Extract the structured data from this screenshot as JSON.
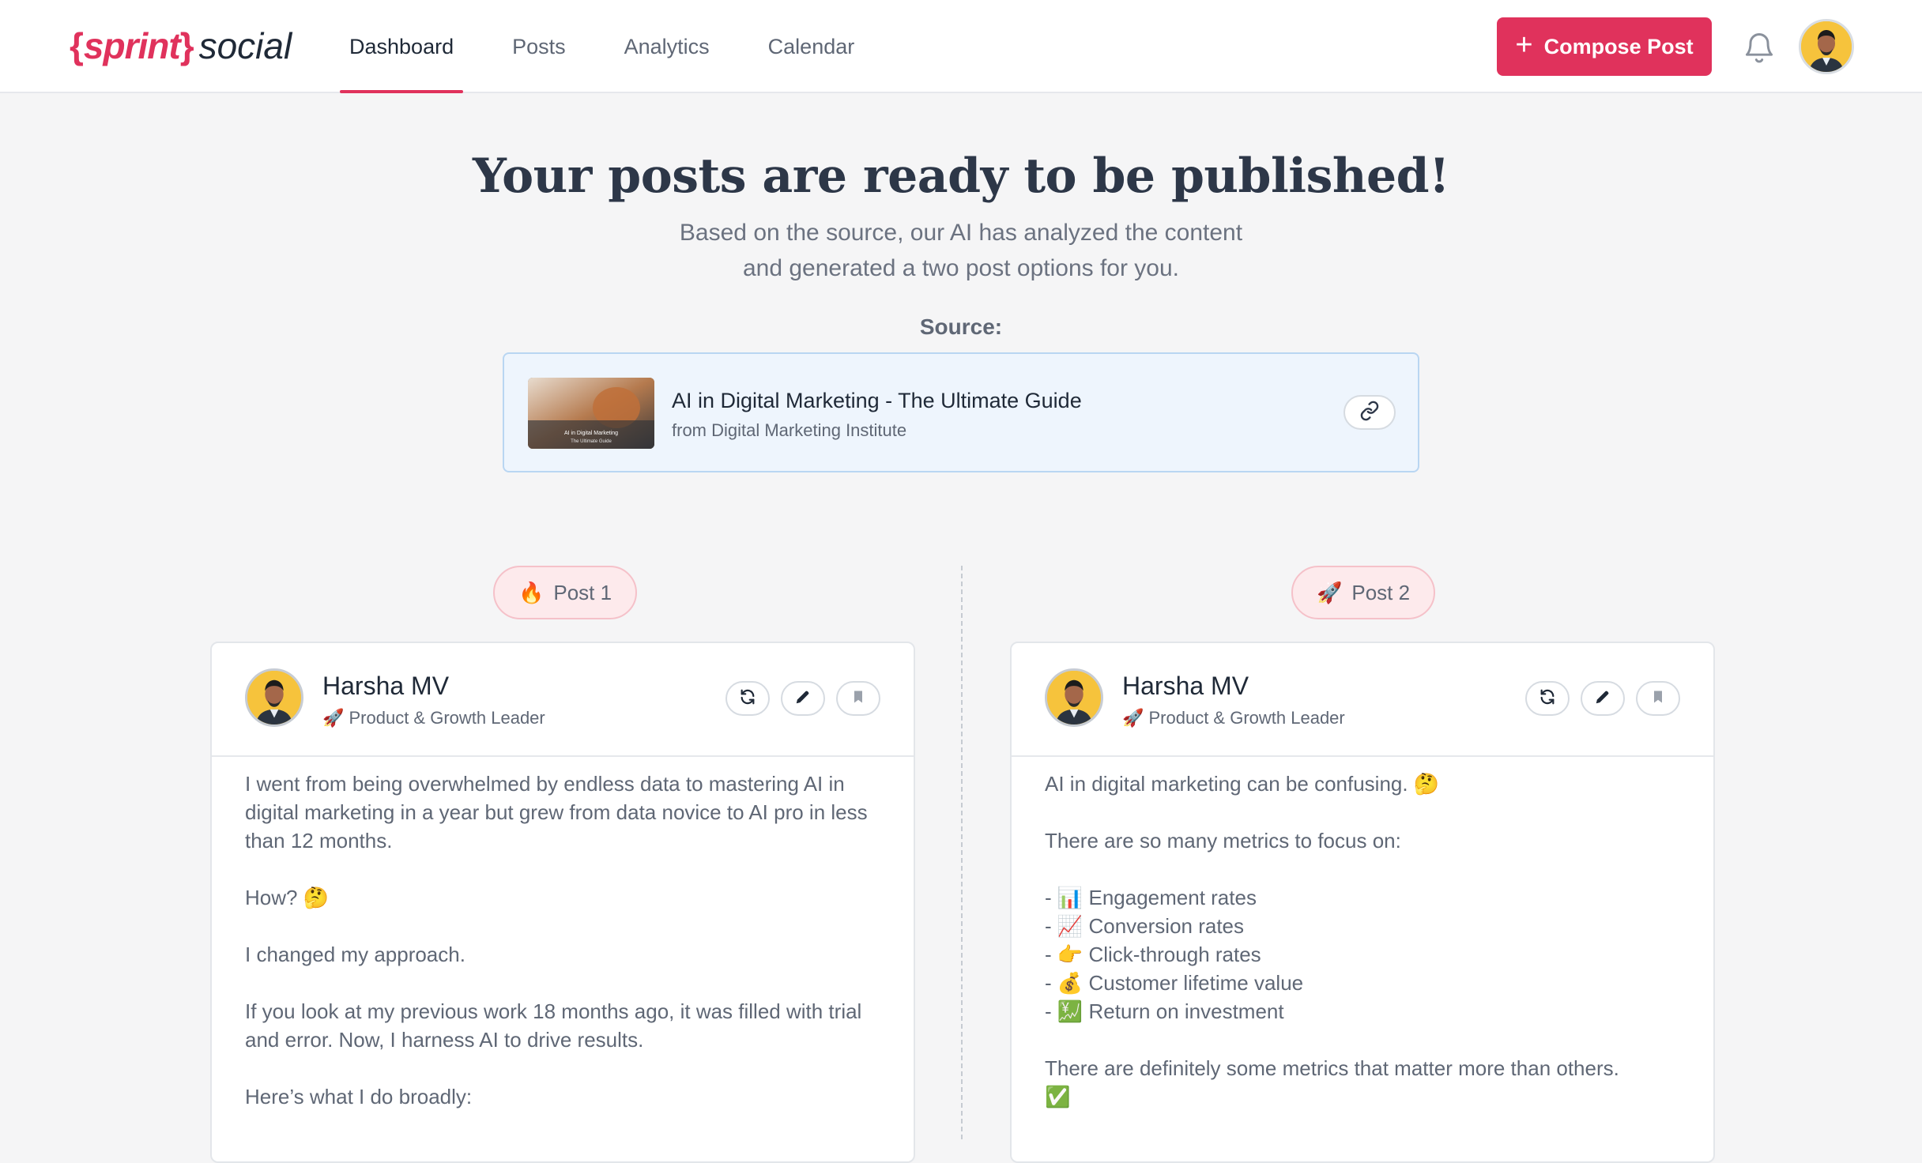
{
  "header": {
    "logo_open_brace": "{",
    "logo_sprint": "sprint",
    "logo_close_brace": "}",
    "logo_social": "social",
    "nav": [
      "Dashboard",
      "Posts",
      "Analytics",
      "Calendar"
    ],
    "active_nav": "Dashboard",
    "compose_label": "Compose Post",
    "compose_icon": "plus-icon",
    "bell_icon": "bell-icon"
  },
  "hero": {
    "title": "Your posts are ready to be published!",
    "subtitle_line1": "Based on the source, our AI has analyzed the content",
    "subtitle_line2": "and generated a two post options for you."
  },
  "source": {
    "label": "Source:",
    "title": "AI in Digital Marketing - The Ultimate Guide",
    "from": "from Digital Marketing Institute",
    "thumb_caption_1": "AI in Digital Marketing",
    "thumb_caption_2": "The Ultimate Guide",
    "link_icon": "link-icon"
  },
  "posts": [
    {
      "tab_emoji": "🔥",
      "tab_label": "Post 1",
      "author": "Harsha MV",
      "role": "🚀 Product & Growth Leader",
      "body": [
        "I went from being overwhelmed by endless data to mastering AI in digital marketing in a year but grew from data novice to AI pro in less than 12 months.",
        "How? 🤔",
        "I changed my approach.",
        "If you look at my previous work 18 months ago, it was filled with trial and error. Now, I harness AI to drive results.",
        "Here’s what I do broadly:"
      ]
    },
    {
      "tab_emoji": "🚀",
      "tab_label": "Post 2",
      "author": "Harsha MV",
      "role": "🚀 Product & Growth Leader",
      "intro": "AI in digital marketing can be confusing. 🤔",
      "lead": "There are so many metrics to focus on:",
      "list": [
        "- 📊 Engagement rates",
        "- 📈 Conversion rates",
        "- 👉 Click-through rates",
        "- 💰 Customer lifetime value",
        "- 💹 Return on investment"
      ],
      "closing": "There are definitely some metrics that matter more than others.",
      "closing_emoji": "✅"
    }
  ],
  "colors": {
    "brand": "#e0325c",
    "source_bg": "#eef5fd",
    "pill_bg": "#fdeaec"
  }
}
